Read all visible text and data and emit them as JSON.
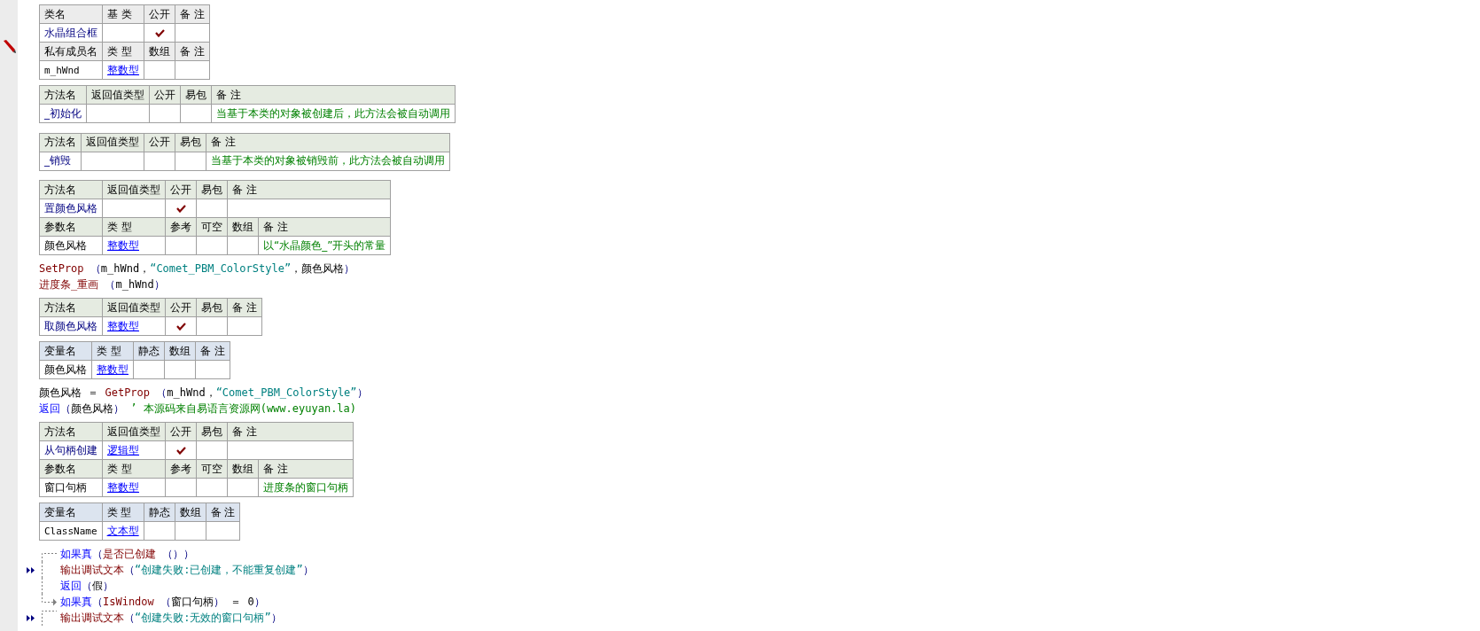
{
  "blocks": [
    {
      "kind": "class_table",
      "rows": [
        {
          "kind": "header",
          "cells": [
            "类名",
            "基 类",
            "公开",
            "备 注"
          ]
        },
        {
          "kind": "data",
          "cells": [
            {
              "kind": "name",
              "text": "水晶组合框"
            },
            {
              "kind": "blank"
            },
            {
              "kind": "flag",
              "checked": true
            },
            {
              "kind": "blank"
            }
          ]
        },
        {
          "kind": "header",
          "cells": [
            "私有成员名",
            "类 型",
            "数组",
            "备 注"
          ]
        },
        {
          "kind": "data",
          "cells": [
            {
              "kind": "mono",
              "text": "m_hWnd"
            },
            {
              "kind": "type",
              "text": "整数型"
            },
            {
              "kind": "flag",
              "checked": false
            },
            {
              "kind": "blank"
            }
          ]
        }
      ]
    },
    {
      "kind": "method_table",
      "rows": [
        {
          "kind": "header",
          "cells": [
            "方法名",
            "返回值类型",
            "公开",
            "易包",
            "备 注"
          ]
        },
        {
          "kind": "data",
          "cells": [
            {
              "kind": "name",
              "text": "_初始化"
            },
            {
              "kind": "blank"
            },
            {
              "kind": "flag",
              "checked": false
            },
            {
              "kind": "flag",
              "checked": false
            },
            {
              "kind": "comment",
              "text": "当基于本类的对象被创建后，此方法会被自动调用"
            }
          ]
        }
      ]
    },
    {
      "kind": "blank"
    },
    {
      "kind": "method_table",
      "rows": [
        {
          "kind": "header",
          "cells": [
            "方法名",
            "返回值类型",
            "公开",
            "易包",
            "备 注"
          ]
        },
        {
          "kind": "data",
          "cells": [
            {
              "kind": "name",
              "text": "_销毁"
            },
            {
              "kind": "blank"
            },
            {
              "kind": "flag",
              "checked": false
            },
            {
              "kind": "flag",
              "checked": false
            },
            {
              "kind": "comment",
              "text": "当基于本类的对象被销毁前，此方法会被自动调用"
            }
          ]
        }
      ]
    },
    {
      "kind": "blank"
    },
    {
      "kind": "method_table",
      "rows": [
        {
          "kind": "header",
          "cells": [
            {
              "text": "方法名"
            },
            {
              "text": "返回值类型"
            },
            {
              "text": "公开"
            },
            {
              "text": "易包"
            },
            {
              "text": "备 注",
              "colspan": 2
            }
          ]
        },
        {
          "kind": "data",
          "cells": [
            {
              "kind": "name",
              "text": "置颜色风格"
            },
            {
              "kind": "blank"
            },
            {
              "kind": "flag",
              "checked": true
            },
            {
              "kind": "flag",
              "checked": false
            },
            {
              "kind": "blank",
              "colspan": 2
            }
          ]
        },
        {
          "kind": "header",
          "cells": [
            "参数名",
            "类 型",
            "参考",
            "可空",
            "数组",
            "备 注"
          ]
        },
        {
          "kind": "data",
          "cells": [
            {
              "kind": "plain",
              "text": "颜色风格"
            },
            {
              "kind": "type",
              "text": "整数型"
            },
            {
              "kind": "flag",
              "checked": false
            },
            {
              "kind": "flag",
              "checked": false
            },
            {
              "kind": "flag",
              "checked": false
            },
            {
              "kind": "comment",
              "text": "以“水晶颜色_”开头的常量"
            }
          ]
        }
      ]
    },
    {
      "kind": "code",
      "lines": [
        {
          "kind": "plain",
          "tokens": [
            {
              "kind": "call",
              "text": "SetProp"
            },
            {
              "kind": "punct",
              "text": " （"
            },
            {
              "kind": "text",
              "text": "m_hWnd，"
            },
            {
              "kind": "string",
              "text": "“Comet_PBM_ColorStyle”"
            },
            {
              "kind": "text",
              "text": "，颜色风格"
            },
            {
              "kind": "punct",
              "text": "）"
            }
          ]
        },
        {
          "kind": "plain",
          "tokens": [
            {
              "kind": "call",
              "text": "进度条_重画"
            },
            {
              "kind": "punct",
              "text": " （"
            },
            {
              "kind": "text",
              "text": "m_hWnd"
            },
            {
              "kind": "punct",
              "text": "）"
            }
          ]
        }
      ]
    },
    {
      "kind": "method_table",
      "rows": [
        {
          "kind": "header",
          "cells": [
            "方法名",
            "返回值类型",
            "公开",
            "易包",
            "备 注"
          ]
        },
        {
          "kind": "data",
          "cells": [
            {
              "kind": "name",
              "text": "取颜色风格"
            },
            {
              "kind": "type",
              "text": "整数型"
            },
            {
              "kind": "flag",
              "checked": true
            },
            {
              "kind": "flag",
              "checked": false
            },
            {
              "kind": "blank"
            }
          ]
        }
      ]
    },
    {
      "kind": "variable_table",
      "rows": [
        {
          "kind": "header",
          "cells": [
            "变量名",
            "类 型",
            "静态",
            "数组",
            "备 注"
          ]
        },
        {
          "kind": "data",
          "cells": [
            {
              "kind": "plain",
              "text": "颜色风格"
            },
            {
              "kind": "type",
              "text": "整数型"
            },
            {
              "kind": "flag",
              "checked": false
            },
            {
              "kind": "flag",
              "checked": false
            },
            {
              "kind": "blank"
            }
          ]
        }
      ]
    },
    {
      "kind": "code",
      "lines": [
        {
          "kind": "plain",
          "tokens": [
            {
              "kind": "text",
              "text": "颜色风格 ＝ "
            },
            {
              "kind": "call",
              "text": "GetProp"
            },
            {
              "kind": "punct",
              "text": " （"
            },
            {
              "kind": "text",
              "text": "m_hWnd，"
            },
            {
              "kind": "string",
              "text": "“Comet_PBM_ColorStyle”"
            },
            {
              "kind": "punct",
              "text": "）"
            }
          ]
        },
        {
          "kind": "plain",
          "tokens": [
            {
              "kind": "keyword",
              "text": "返回"
            },
            {
              "kind": "punct",
              "text": "（"
            },
            {
              "kind": "text",
              "text": "颜色风格"
            },
            {
              "kind": "punct",
              "text": "）"
            },
            {
              "kind": "comment",
              "text": " ’ 本源码来自易语言资源网(www.eyuyan.la)"
            }
          ]
        }
      ]
    },
    {
      "kind": "method_table",
      "rows": [
        {
          "kind": "header",
          "cells": [
            {
              "text": "方法名"
            },
            {
              "text": "返回值类型"
            },
            {
              "text": "公开"
            },
            {
              "text": "易包"
            },
            {
              "text": "备 注",
              "colspan": 2
            }
          ]
        },
        {
          "kind": "data",
          "cells": [
            {
              "kind": "name",
              "text": "从句柄创建"
            },
            {
              "kind": "type",
              "text": "逻辑型"
            },
            {
              "kind": "flag",
              "checked": true
            },
            {
              "kind": "flag",
              "checked": false
            },
            {
              "kind": "blank",
              "colspan": 2
            }
          ]
        },
        {
          "kind": "header",
          "cells": [
            "参数名",
            "类 型",
            "参考",
            "可空",
            "数组",
            "备 注"
          ]
        },
        {
          "kind": "data",
          "cells": [
            {
              "kind": "plain",
              "text": "窗口句柄"
            },
            {
              "kind": "type",
              "text": "整数型"
            },
            {
              "kind": "flag",
              "checked": false
            },
            {
              "kind": "flag",
              "checked": false
            },
            {
              "kind": "flag",
              "checked": false
            },
            {
              "kind": "comment",
              "text": "进度条的窗口句柄"
            }
          ]
        }
      ]
    },
    {
      "kind": "variable_table",
      "rows": [
        {
          "kind": "header",
          "cells": [
            "变量名",
            "类 型",
            "静态",
            "数组",
            "备 注"
          ]
        },
        {
          "kind": "data",
          "cells": [
            {
              "kind": "mono",
              "text": "ClassName"
            },
            {
              "kind": "type",
              "text": "文本型"
            },
            {
              "kind": "flag",
              "checked": false
            },
            {
              "kind": "flag",
              "checked": false
            },
            {
              "kind": "blank"
            }
          ]
        }
      ]
    },
    {
      "kind": "code",
      "lines": [
        {
          "kind": "flow_open",
          "marker": false,
          "tokens": [
            {
              "kind": "keyword",
              "text": "如果真"
            },
            {
              "kind": "punct",
              "text": "（"
            },
            {
              "kind": "call",
              "text": "是否已创建"
            },
            {
              "kind": "punct",
              "text": " （））"
            }
          ]
        },
        {
          "kind": "flow_through",
          "marker": true,
          "tokens": [
            {
              "kind": "call",
              "text": "输出调试文本"
            },
            {
              "kind": "punct",
              "text": "（"
            },
            {
              "kind": "string",
              "text": "“创建失败:已创建，不能重复创建”"
            },
            {
              "kind": "punct",
              "text": "）"
            }
          ]
        },
        {
          "kind": "flow_through",
          "marker": false,
          "tokens": [
            {
              "kind": "keyword",
              "text": "返回"
            },
            {
              "kind": "punct",
              "text": "（"
            },
            {
              "kind": "text",
              "text": "假"
            },
            {
              "kind": "punct",
              "text": "）"
            }
          ]
        },
        {
          "kind": "flow_close",
          "marker": false,
          "tokens": [
            {
              "kind": "keyword",
              "text": "如果真"
            },
            {
              "kind": "punct",
              "text": "（"
            },
            {
              "kind": "call",
              "text": "IsWindow"
            },
            {
              "kind": "punct",
              "text": " （"
            },
            {
              "kind": "text",
              "text": "窗口句柄"
            },
            {
              "kind": "punct",
              "text": "）"
            },
            {
              "kind": "text",
              "text": " ＝ 0"
            },
            {
              "kind": "punct",
              "text": "）"
            }
          ]
        },
        {
          "kind": "flow_open_top",
          "marker": true,
          "tokens": [
            {
              "kind": "call",
              "text": "输出调试文本"
            },
            {
              "kind": "punct",
              "text": "（"
            },
            {
              "kind": "string",
              "text": "“创建失败:无效的窗口句柄”"
            },
            {
              "kind": "punct",
              "text": "）"
            }
          ]
        }
      ]
    }
  ]
}
